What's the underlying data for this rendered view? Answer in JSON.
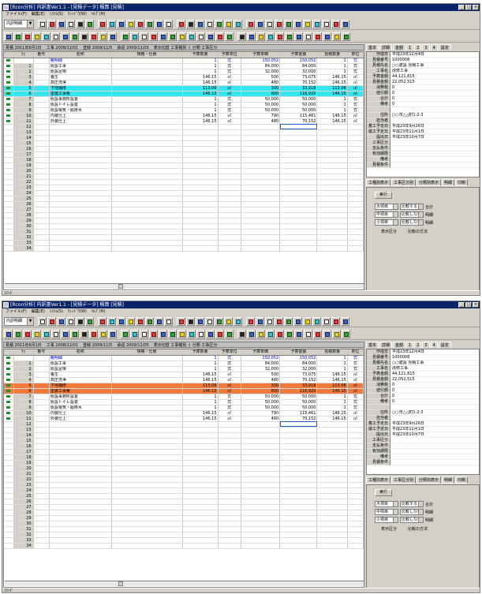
{
  "window": {
    "title": "[Rcon分析] 内訳書Ver1.1 - [見積データ] 積算 [見積]",
    "menu": [
      "ファイル(F)",
      "編集(E)",
      "ｼｽﾃﾑ(S)",
      "ｳｨﾝﾄﾞｳ(W)",
      "ﾍﾙﾌﾟ(H)"
    ],
    "combo_value": "内訳明細"
  },
  "infobar": {
    "date": "見積 2011年6月1日",
    "project_date": "工事 2008/12/01",
    "code": "登録 2009/11/5",
    "amount": "承認 2009/11/05",
    "extra": "表示切替 工事種別 ⇩ 分類 工事区分"
  },
  "grid": {
    "headers": [
      "行",
      "番号",
      "名称",
      "規格・仕様",
      "予算数量",
      "予算単位",
      "予算単価",
      "予算金額",
      "見積数量",
      "単位"
    ],
    "summary_row": {
      "label": "親明細",
      "qty": "1",
      "unit": "式",
      "price": "150,052",
      "amount": "150,052",
      "est_qty": "1",
      "est_unit": "式"
    },
    "rows": [
      {
        "no": "1",
        "code": "",
        "name": "仮設工事",
        "spec": "",
        "qty": "1",
        "unit": "式",
        "price": "84,000",
        "amount": "84,000",
        "est_qty": "1",
        "est_unit": "式",
        "highlight": false
      },
      {
        "no": "2",
        "code": "",
        "name": "仮設足場",
        "spec": "",
        "qty": "1",
        "unit": "式",
        "price": "32,000",
        "amount": "32,000",
        "est_qty": "1",
        "est_unit": "式",
        "highlight": false
      },
      {
        "no": "3",
        "code": "",
        "name": "養生",
        "spec": "",
        "qty": "146.15",
        "unit": "㎡",
        "price": "500",
        "amount": "73,075",
        "est_qty": "146.15",
        "est_unit": "㎡",
        "highlight": false
      },
      {
        "no": "4",
        "code": "",
        "name": "高圧洗浄",
        "spec": "",
        "qty": "146.15",
        "unit": "㎡",
        "price": "480",
        "amount": "70,152",
        "est_qty": "146.15",
        "est_unit": "㎡",
        "highlight": false
      },
      {
        "no": "5",
        "code": "",
        "name": "下地補修",
        "spec": "",
        "qty": "113.06",
        "unit": "㎡",
        "price": "300",
        "amount": "33,918",
        "est_qty": "113.06",
        "est_unit": "㎡",
        "highlight": true
      },
      {
        "no": "6",
        "code": "",
        "name": "塗装工事費",
        "spec": "",
        "qty": "146.15",
        "unit": "㎡",
        "price": "800",
        "amount": "116,920",
        "est_qty": "146.15",
        "est_unit": "㎡",
        "highlight": true
      },
      {
        "no": "7",
        "code": "",
        "name": "仮設事務所設置",
        "spec": "",
        "qty": "1",
        "unit": "式",
        "price": "50,000",
        "amount": "50,000",
        "est_qty": "1",
        "est_unit": "式",
        "highlight": false
      },
      {
        "no": "8",
        "code": "",
        "name": "仮設トイレ設置",
        "spec": "",
        "qty": "1",
        "unit": "式",
        "price": "50,000",
        "amount": "50,000",
        "est_qty": "1",
        "est_unit": "式",
        "highlight": false
      },
      {
        "no": "9",
        "code": "",
        "name": "仮設電気・給排水",
        "spec": "",
        "qty": "1",
        "unit": "式",
        "price": "50,000",
        "amount": "50,000",
        "est_qty": "1",
        "est_unit": "式",
        "highlight": false
      },
      {
        "no": "10",
        "code": "",
        "name": "内装仕上",
        "spec": "",
        "qty": "146.15",
        "unit": "㎡",
        "price": "790",
        "amount": "115,461",
        "est_qty": "146.15",
        "est_unit": "㎡",
        "highlight": false
      },
      {
        "no": "11",
        "code": "",
        "name": "外装仕上",
        "spec": "",
        "qty": "146.15",
        "unit": "㎡",
        "price": "480",
        "amount": "70,152",
        "est_qty": "146.15",
        "est_unit": "㎡",
        "highlight": false
      }
    ],
    "empty_row_numbers": [
      "12",
      "13",
      "14",
      "15",
      "16",
      "17",
      "18",
      "19",
      "20",
      "21",
      "22",
      "23",
      "24",
      "25",
      "26",
      "27",
      "28",
      "29",
      "30",
      "31",
      "32",
      "33",
      "34"
    ]
  },
  "props": {
    "tabs": [
      "基本",
      "詳細",
      "金額",
      "1",
      "2",
      "3",
      "4",
      "設定"
    ],
    "rows": [
      {
        "k": "作成日",
        "v": "平成23年12月4日"
      },
      {
        "k": "見積番号",
        "v": "1000008"
      },
      {
        "k": "見積先名",
        "v": "○○建設 見積工事"
      },
      {
        "k": "工事名",
        "v": "改修工事"
      },
      {
        "k": "予算金額",
        "v": "44,121,815"
      },
      {
        "k": "見積金額",
        "v": "22,052,515"
      },
      {
        "k": "消費税",
        "v": "0"
      },
      {
        "k": "値引額",
        "v": "0"
      },
      {
        "k": "合計",
        "v": "0"
      },
      {
        "k": "備考",
        "v": "0"
      },
      {
        "k": "",
        "v": ""
      },
      {
        "k": "住所",
        "v": "○○市△△町1-2-3"
      },
      {
        "k": "担当者",
        "v": ""
      },
      {
        "k": "着工予定日",
        "v": "平成23年9月26日"
      },
      {
        "k": "竣工予定日",
        "v": "平成23年11月1日"
      },
      {
        "k": "提出日",
        "v": "平成23年10月7日"
      },
      {
        "k": "工事区分",
        "v": ""
      },
      {
        "k": "支払条件",
        "v": ""
      },
      {
        "k": "有効期限",
        "v": ""
      },
      {
        "k": "備考",
        "v": ""
      },
      {
        "k": "見積条件",
        "v": ""
      }
    ]
  },
  "panel_tabs": [
    "工種別表示",
    "工事区分別",
    "分類別表示",
    "明細",
    "印刷"
  ],
  "filters": {
    "button": "実行",
    "rows": [
      {
        "a": "大項目",
        "b": "比較する",
        "c": "合計"
      },
      {
        "a": "中項目",
        "b": "比較しない",
        "c": "明細"
      },
      {
        "a": "小項目",
        "b": "比較しない",
        "c": "明細"
      }
    ],
    "labels": [
      "表示区分",
      "比較の方法"
    ]
  },
  "status": "ｺﾏﾝﾄﾞ",
  "colors": {
    "highlight_top": "#33e6f0",
    "highlight_bottom": "#f07a3c",
    "title_bar": "#0a246a",
    "row_marker": "#2a8a2a",
    "summary_text": "#0000c0"
  }
}
